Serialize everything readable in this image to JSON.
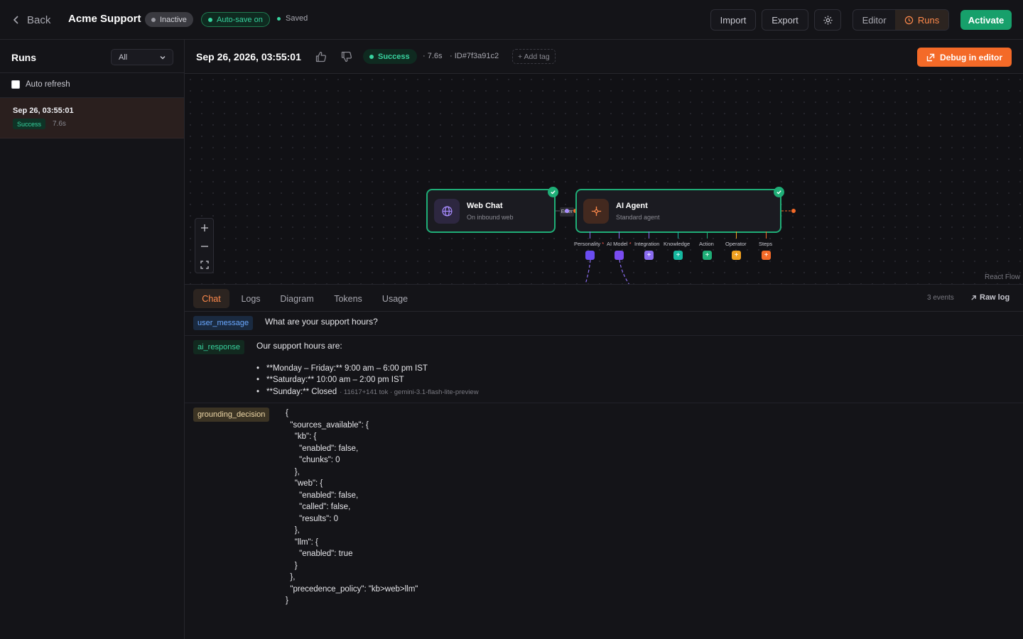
{
  "header": {
    "back_label": "Back",
    "title": "Acme Support",
    "status": "Inactive",
    "autosave": "Auto-save on",
    "saved": "Saved",
    "import_label": "Import",
    "export_label": "Export",
    "editor_label": "Editor",
    "runs_label": "Runs",
    "activate_label": "Activate"
  },
  "sidebar": {
    "title": "Runs",
    "filter_value": "All",
    "auto_refresh_label": "Auto refresh",
    "auto_refresh_checked": false,
    "runs": [
      {
        "date": "Sep 26, 03:55:01",
        "status": "Success",
        "duration": "7.6s"
      }
    ]
  },
  "run": {
    "datetime": "Sep 26, 2026, 03:55:01",
    "status": "Success",
    "duration": "· 7.6s",
    "id": "· ID#7f3a91c2",
    "add_tag": "+ Add tag",
    "debug_label": "Debug in editor"
  },
  "canvas": {
    "attribution": "React Flow",
    "edge_label": "Enter",
    "nodes": [
      {
        "title": "Web Chat",
        "subtitle": "On inbound web",
        "icon": "globe-icon"
      },
      {
        "title": "AI Agent",
        "subtitle": "Standard agent",
        "icon": "sparkle-icon"
      }
    ],
    "slots": [
      {
        "label": "Personality",
        "required": true,
        "color": "#6a4cf0"
      },
      {
        "label": "AI Model",
        "required": true,
        "color": "#7a4cf0"
      },
      {
        "label": "Integration",
        "required": false,
        "color": "#8a6cf0"
      },
      {
        "label": "Knowledge",
        "required": false,
        "color": "#16b8a0"
      },
      {
        "label": "Action",
        "required": false,
        "color": "#1fae77"
      },
      {
        "label": "Operator",
        "required": false,
        "color": "#f0a020"
      },
      {
        "label": "Steps",
        "required": false,
        "color": "#f46a28"
      }
    ],
    "colors": {
      "accent_green": "#1fae77",
      "accent_orange": "#f46a28"
    }
  },
  "tabs": {
    "items": [
      "Chat",
      "Logs",
      "Diagram",
      "Tokens",
      "Usage"
    ],
    "active": "Chat",
    "events_count": "3 events",
    "raw_log": "Raw log"
  },
  "events": {
    "user": {
      "tag": "user_message",
      "text": "What are your support hours?"
    },
    "ai": {
      "tag": "ai_response",
      "intro": "Our support hours are:",
      "lines": [
        "**Monday – Friday:** 9:00 am – 6:00 pm IST",
        "**Saturday:** 10:00 am – 2:00 pm IST",
        "**Sunday:** Closed"
      ],
      "meta": "· 11617+141 tok · gemini-3.1-flash-lite-preview"
    },
    "grounding": {
      "tag": "grounding_decision",
      "lines": [
        "{",
        "  \"sources_available\": {",
        "    \"kb\": {",
        "      \"enabled\": false,",
        "      \"chunks\": 0",
        "    },",
        "    \"web\": {",
        "      \"enabled\": false,",
        "      \"called\": false,",
        "      \"results\": 0",
        "    },",
        "    \"llm\": {",
        "      \"enabled\": true",
        "    }",
        "  },",
        "  \"precedence_policy\": \"kb>web>llm\"",
        "}"
      ]
    }
  }
}
